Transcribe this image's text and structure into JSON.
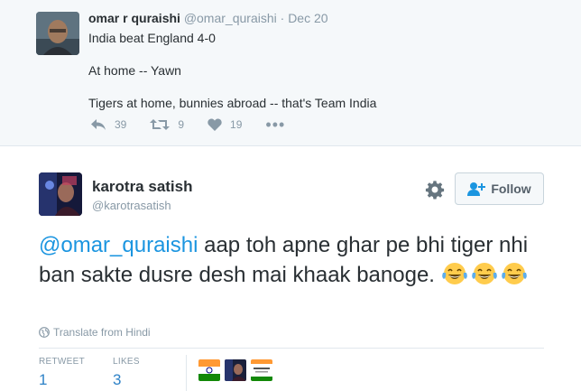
{
  "parent_tweet": {
    "name": "omar r quraishi",
    "handle": "@omar_quraishi",
    "separator": "·",
    "date": "Dec 20",
    "lines": [
      "India beat England 4-0",
      "At home -- Yawn",
      "Tigers at home, bunnies abroad -- that's Team India"
    ],
    "reply_count": "39",
    "retweet_count": "9",
    "like_count": "19",
    "more": "•••"
  },
  "tweet": {
    "name": "karotra satish",
    "handle": "@karotrasatish",
    "follow_label": "Follow",
    "mention": "@omar_quraishi",
    "text_after_mention": " aap toh apne ghar pe bhi tiger nhi ban sakte dusre desh mai khaak banoge.",
    "emoji": [
      "face-with-tears-of-joy",
      "face-with-tears-of-joy",
      "face-with-tears-of-joy"
    ],
    "translate_label": "Translate from Hindi",
    "retweet_label": "RETWEET",
    "retweet_count": "1",
    "likes_label": "LIKES",
    "likes_count": "3"
  },
  "colors": {
    "link": "#1b95e0",
    "count": "#2e82c7",
    "muted": "#8899a6",
    "parent_bg": "#f5f8fa"
  }
}
